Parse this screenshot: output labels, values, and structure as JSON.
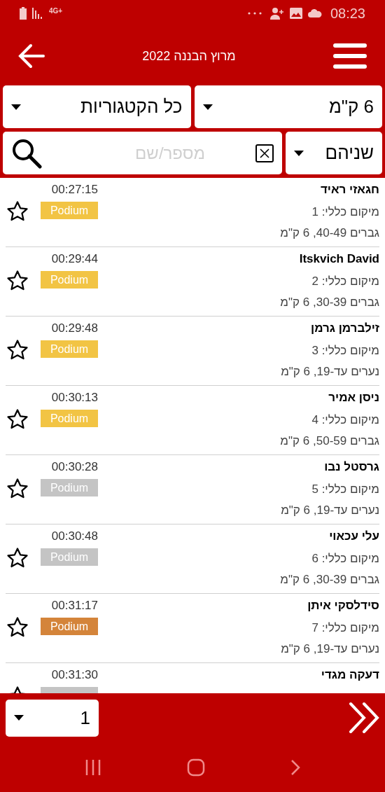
{
  "status_bar": {
    "time": "08:23",
    "network": "4G+"
  },
  "header": {
    "title": "מרוץ הבננה 2022"
  },
  "filters": {
    "distance": "6 ק\"מ",
    "category": "כל הקטגוריות",
    "gender": "שניהם",
    "search": {
      "placeholder": "מספר/שם"
    }
  },
  "results": [
    {
      "name": "חגאזי ראיד",
      "time": "00:27:15",
      "overall": "מיקום כללי: 1",
      "category": "גברים 40-49, 6 ק\"מ",
      "badge": {
        "label": "Podium",
        "color": "#f2c444"
      },
      "favorite": false
    },
    {
      "name": "Itskvich David",
      "time": "00:29:44",
      "overall": "מיקום כללי: 2",
      "category": "גברים 30-39, 6 ק\"מ",
      "badge": {
        "label": "Podium",
        "color": "#f2c444"
      },
      "favorite": false
    },
    {
      "name": "זילברמן גרמן",
      "time": "00:29:48",
      "overall": "מיקום כללי: 3",
      "category": "נערים עד-19, 6 ק\"מ",
      "badge": {
        "label": "Podium",
        "color": "#f2c444"
      },
      "favorite": false
    },
    {
      "name": "ניסן אמיר",
      "time": "00:30:13",
      "overall": "מיקום כללי: 4",
      "category": "גברים 50-59, 6 ק\"מ",
      "badge": {
        "label": "Podium",
        "color": "#f2c444"
      },
      "favorite": false
    },
    {
      "name": "גרסטל נבו",
      "time": "00:30:28",
      "overall": "מיקום כללי: 5",
      "category": "נערים עד-19, 6 ק\"מ",
      "badge": {
        "label": "Podium",
        "color": "#c4c4c4"
      },
      "favorite": false
    },
    {
      "name": "עלי עכאוי",
      "time": "00:30:48",
      "overall": "מיקום כללי: 6",
      "category": "גברים 30-39, 6 ק\"מ",
      "badge": {
        "label": "Podium",
        "color": "#c4c4c4"
      },
      "favorite": false
    },
    {
      "name": "סידלסקי איתן",
      "time": "00:31:17",
      "overall": "מיקום כללי: 7",
      "category": "נערים עד-19, 6 ק\"מ",
      "badge": {
        "label": "Podium",
        "color": "#d4843a"
      },
      "favorite": false
    },
    {
      "name": "דעקה מגדי",
      "time": "00:31:30",
      "badge": {
        "color": "#c4c4c4"
      },
      "favorite": false
    }
  ],
  "pager": {
    "page": "1"
  }
}
